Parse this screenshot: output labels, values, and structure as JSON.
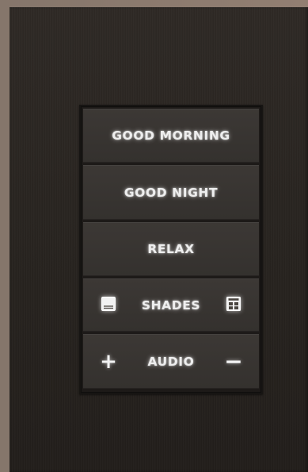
{
  "keypad": {
    "buttons": [
      {
        "label": "GOOD MORNING"
      },
      {
        "label": "GOOD NIGHT"
      },
      {
        "label": "RELAX"
      },
      {
        "label": "SHADES",
        "left_icon": "shade-down-icon",
        "right_icon": "shade-up-icon"
      },
      {
        "label": "AUDIO",
        "left_icon": "plus-icon",
        "left_symbol": "+",
        "right_icon": "minus-icon",
        "right_symbol": "−"
      }
    ]
  },
  "colors": {
    "wall": "#8a7b70",
    "faceplate": "#2a2622",
    "button": "#38342f",
    "label_glow": "#eeeeee"
  }
}
